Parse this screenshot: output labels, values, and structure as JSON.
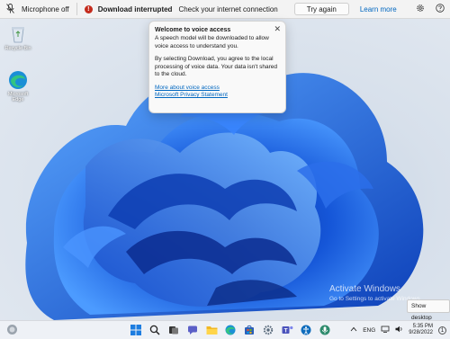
{
  "voice_bar": {
    "mic_status": "Microphone off",
    "error_title": "Download interrupted",
    "error_message": "Check your internet connection",
    "try_again": "Try again",
    "learn_more": "Learn more"
  },
  "popup": {
    "title": "Welcome to voice access",
    "para1": "A speech model will be downloaded to allow voice access to understand you.",
    "para2": "By selecting Download, you agree to the local processing of voice data. Your data isn't shared to the cloud.",
    "link1": "More about voice access",
    "link2": "Microsoft Privacy Statement"
  },
  "desktop_icons": [
    {
      "label": "Recycle Bin",
      "icon": "recycle-bin-icon"
    },
    {
      "label": "Microsoft Edge",
      "icon": "edge-icon"
    }
  ],
  "watermark": {
    "title": "Activate Windows",
    "subtitle": "Go to Settings to activate Windows."
  },
  "show_desktop": "Show desktop",
  "taskbar": {
    "language": "ENG",
    "time": "5:35 PM",
    "date": "9/28/2022",
    "notification_count": "1"
  },
  "colors": {
    "accent": "#0067c0",
    "error": "#c42b1c",
    "bloom_dark": "#0b3fb3",
    "bloom_light": "#3b8bff"
  }
}
